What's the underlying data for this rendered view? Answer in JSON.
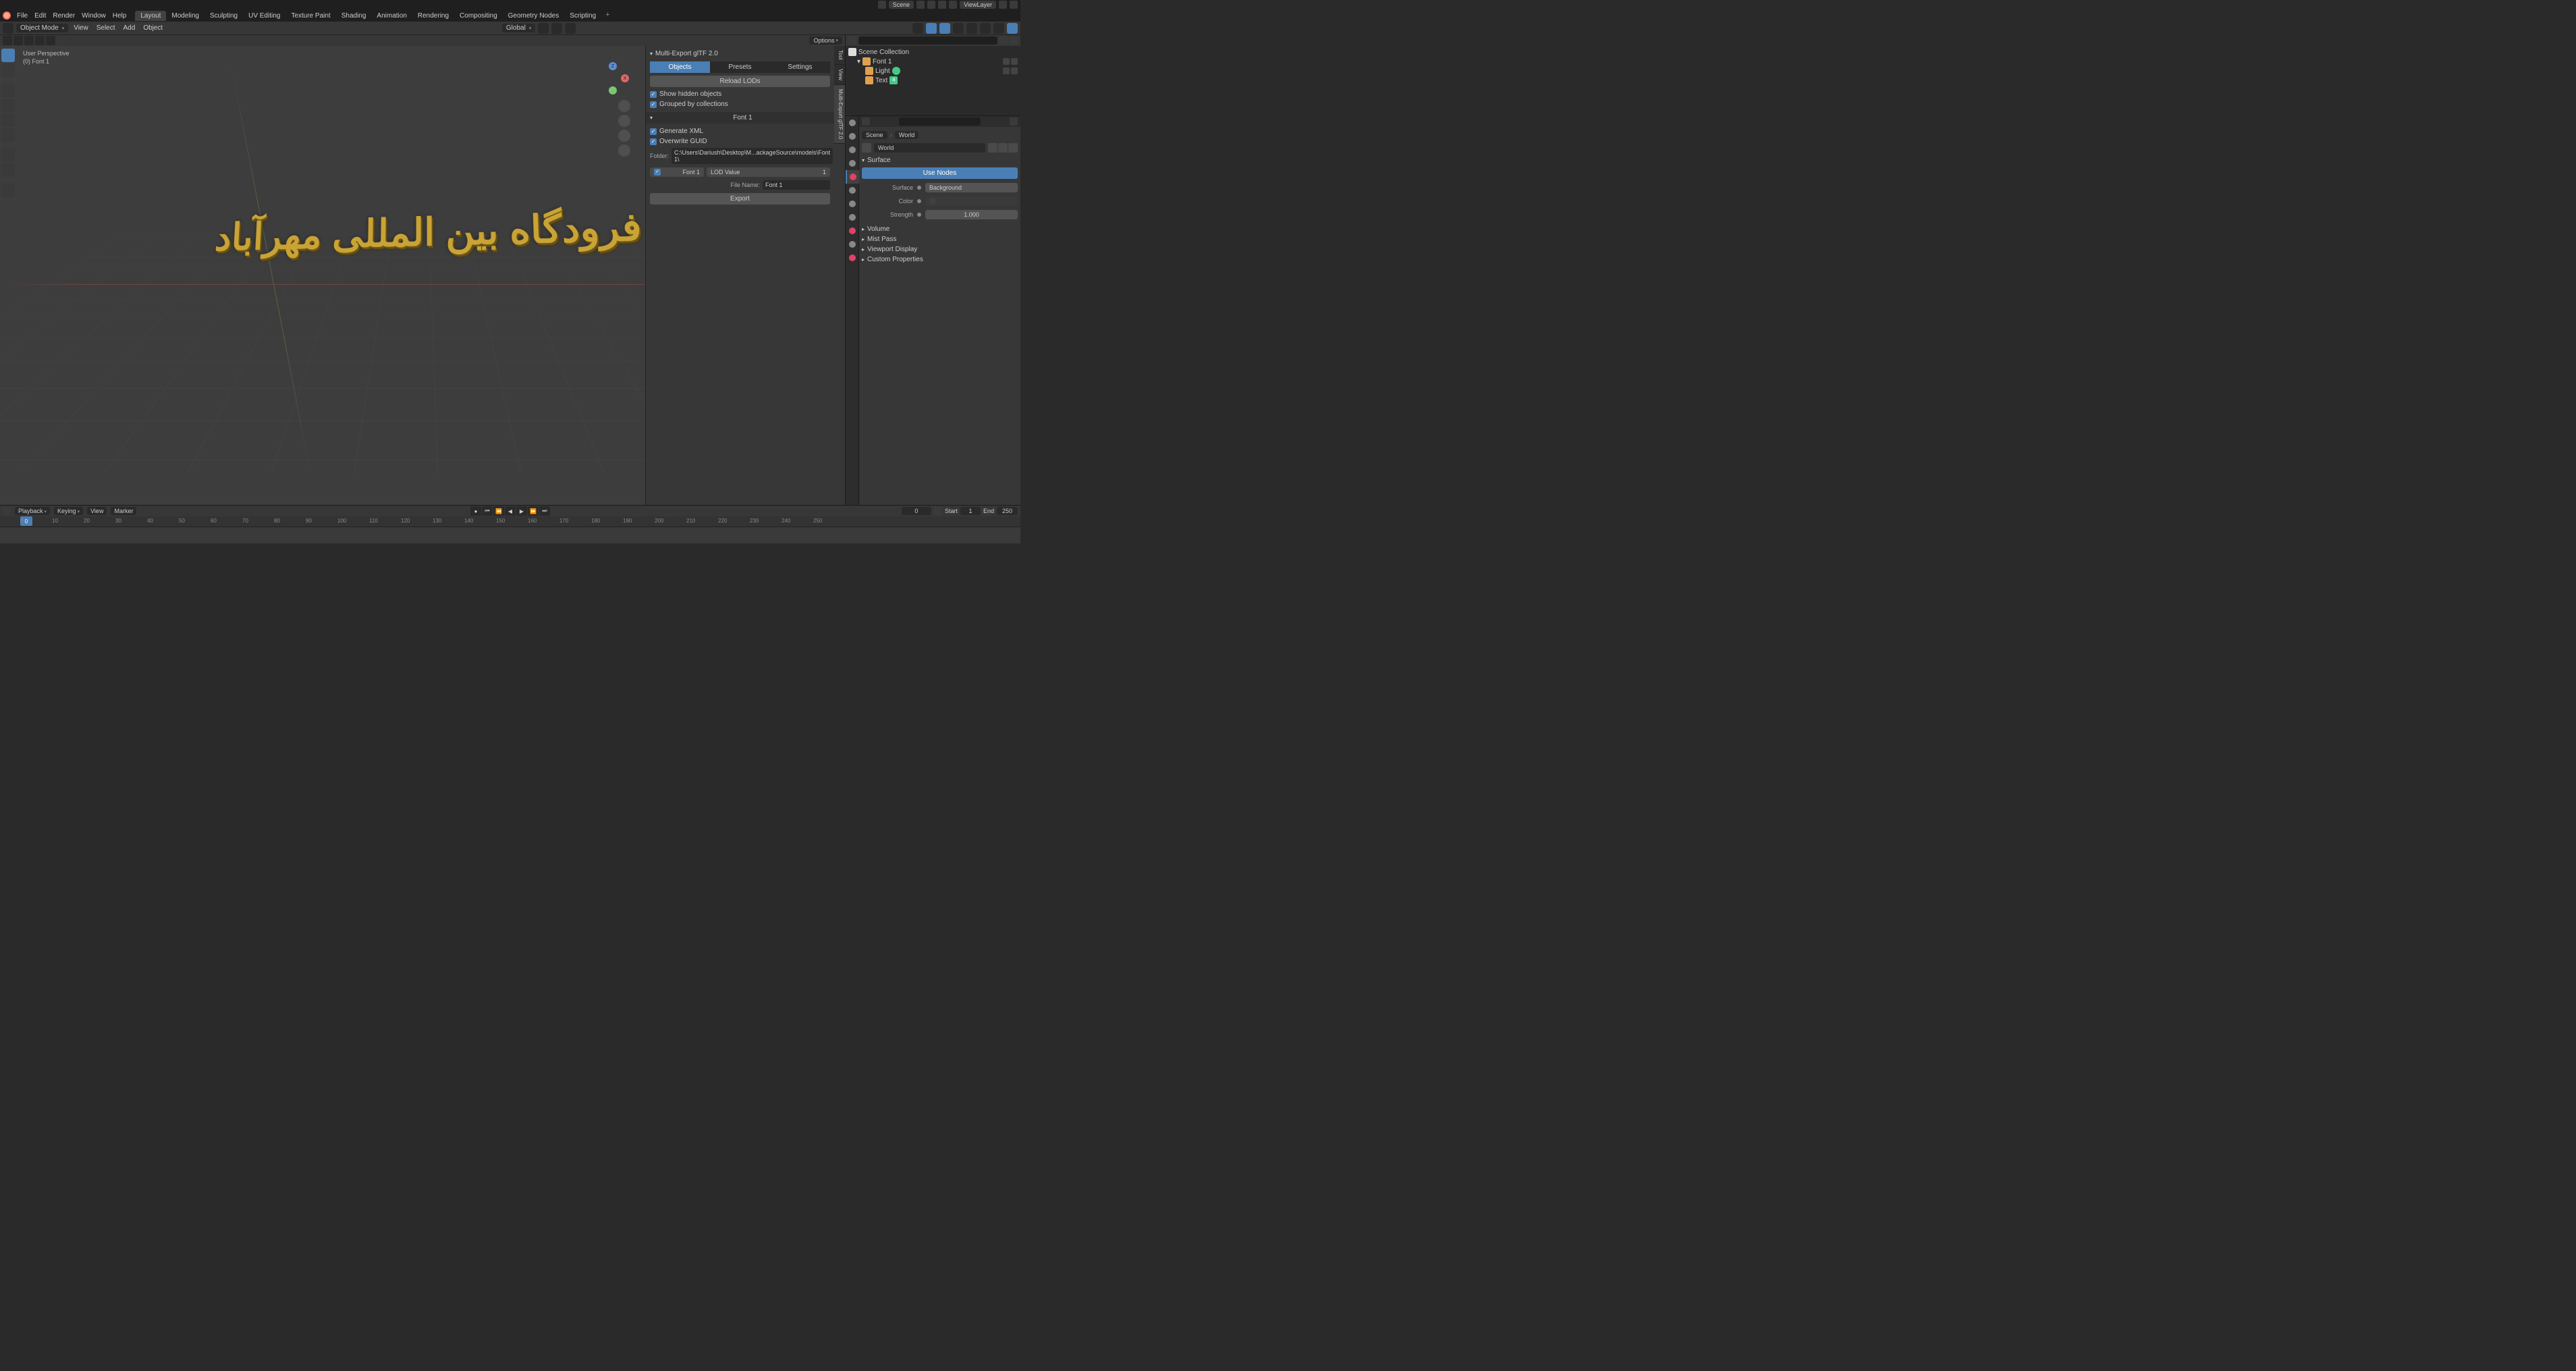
{
  "topstrip": {
    "scene_label": "Scene",
    "viewlayer_label": "ViewLayer"
  },
  "menu": {
    "items": [
      "File",
      "Edit",
      "Render",
      "Window",
      "Help"
    ],
    "workspaces": [
      "Layout",
      "Modeling",
      "Sculpting",
      "UV Editing",
      "Texture Paint",
      "Shading",
      "Animation",
      "Rendering",
      "Compositing",
      "Geometry Nodes",
      "Scripting"
    ],
    "active_ws": "Layout"
  },
  "subheader": {
    "mode": "Object Mode",
    "view": "View",
    "select": "Select",
    "add": "Add",
    "object": "Object",
    "orientation": "Global"
  },
  "viewport": {
    "options": "Options",
    "info_line1": "User Perspective",
    "info_line2": "(0) Font 1",
    "text3d": "فرودگاه بین المللی مهرآباد"
  },
  "npanel": {
    "title": "Multi-Export glTF 2.0",
    "tabs": [
      "Objects",
      "Presets",
      "Settings"
    ],
    "vtabs": [
      "Tool",
      "View",
      "Multi-Export glTF 2.0"
    ],
    "reload": "Reload LODs",
    "show_hidden": "Show hidden objects",
    "grouped": "Grouped by collections",
    "obj_section": "Font 1",
    "gen_xml": "Generate XML",
    "overwrite": "Overwrite GUID",
    "folder_label": "Folder:",
    "folder_value": "C:\\Users\\Dariush\\Desktop\\M...ackageSource\\models\\Font 1\\",
    "font_chk": "Font 1",
    "lod_label": "LOD Value",
    "lod_value": "1",
    "filename_label": "File Name:",
    "filename_value": "Font 1",
    "export": "Export"
  },
  "outliner": {
    "scene_collection": "Scene Collection",
    "items": [
      {
        "name": "Font 1",
        "icon": "#e0a050",
        "depth": 1
      },
      {
        "name": "Light",
        "icon": "#45c988",
        "depth": 2
      },
      {
        "name": "Text",
        "icon": "#45c988",
        "depth": 2
      }
    ]
  },
  "properties": {
    "crumb_scene": "Scene",
    "crumb_world": "World",
    "world_dd": "World",
    "surface_section": "Surface",
    "use_nodes": "Use Nodes",
    "surface_label": "Surface",
    "surface_value": "Background",
    "color_label": "Color",
    "strength_label": "Strength",
    "strength_value": "1.000",
    "sections": [
      "Volume",
      "Mist Pass",
      "Viewport Display",
      "Custom Properties"
    ]
  },
  "timeline": {
    "playback": "Playback",
    "keying": "Keying",
    "view": "View",
    "marker": "Marker",
    "current": "0",
    "start_label": "Start",
    "start": "1",
    "end_label": "End",
    "end": "250",
    "ticks": [
      "0",
      "10",
      "20",
      "30",
      "40",
      "50",
      "60",
      "70",
      "80",
      "90",
      "100",
      "110",
      "120",
      "130",
      "140",
      "150",
      "160",
      "170",
      "180",
      "190",
      "200",
      "210",
      "220",
      "230",
      "240",
      "250"
    ]
  }
}
